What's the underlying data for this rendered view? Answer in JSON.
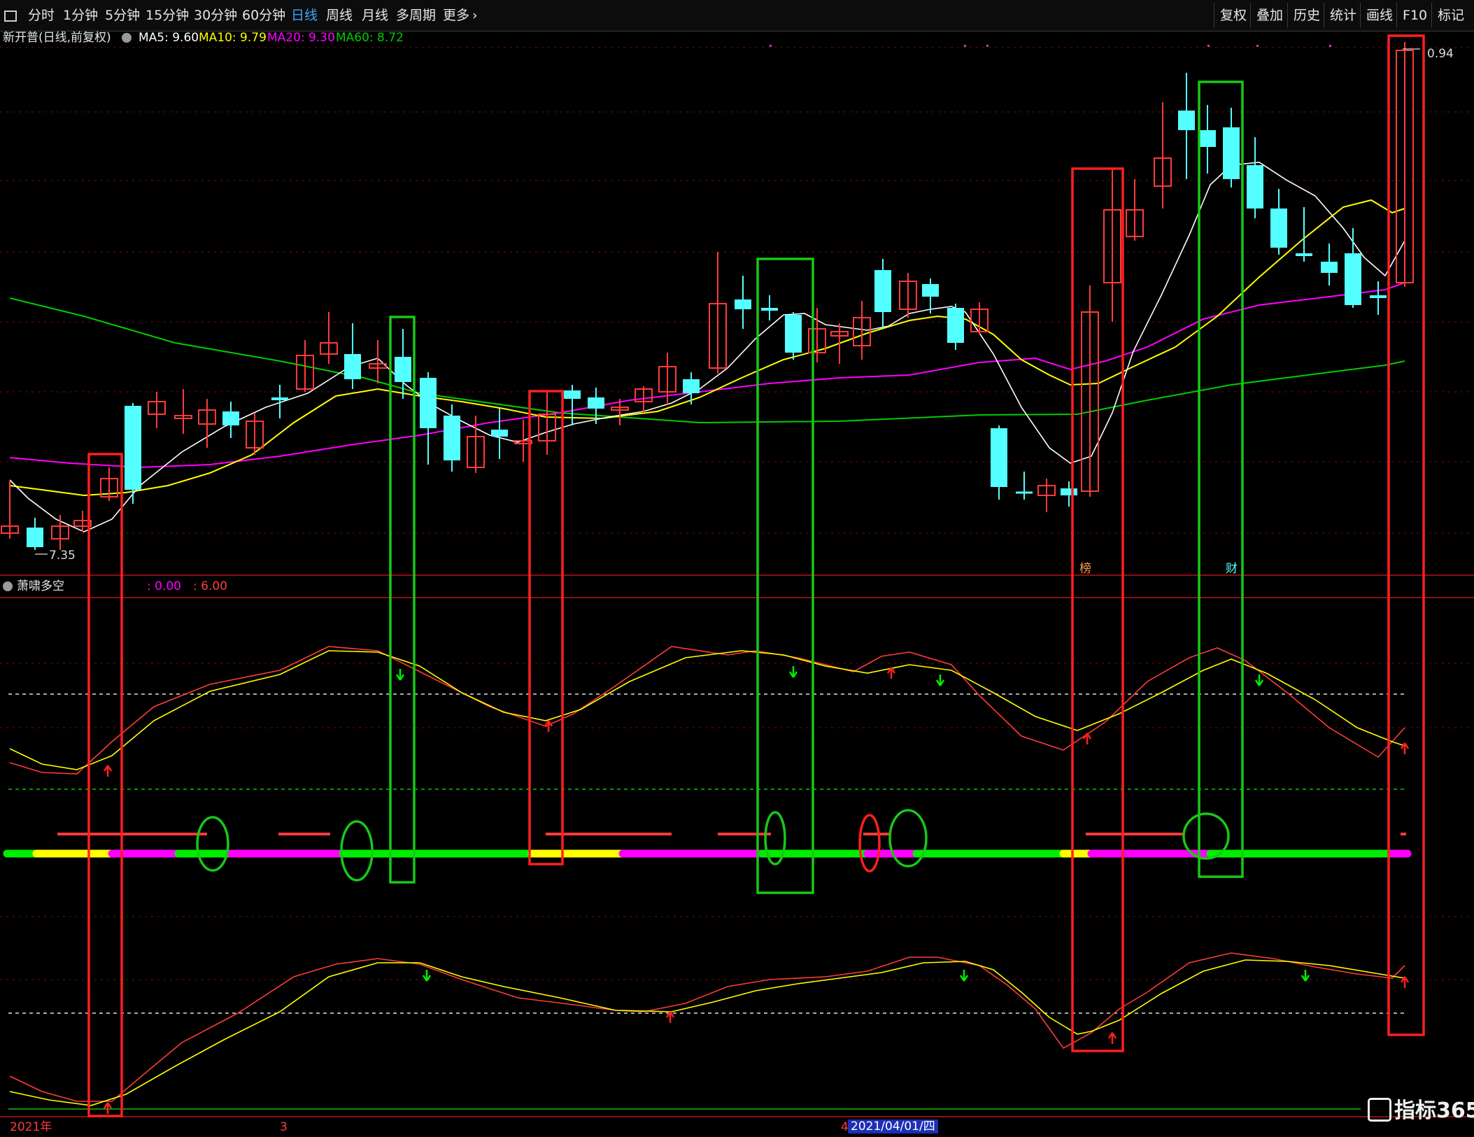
{
  "toolbar": {
    "menu_icon": "square-menu-icon",
    "periods": [
      "分时",
      "1分钟",
      "5分钟",
      "15分钟",
      "30分钟",
      "60分钟",
      "日线",
      "周线",
      "月线",
      "多周期",
      "更多"
    ],
    "active_period": "日线",
    "right_buttons": [
      "复权",
      "叠加",
      "历史",
      "统计",
      "画线",
      "F10",
      "标记"
    ]
  },
  "stock": {
    "name": "新开普(日线,前复权)",
    "ma5": "MA5: 9.60",
    "ma10": "MA10: 9.79",
    "ma20": "MA20: 9.30",
    "ma60": "MA60: 8.72",
    "low_label": "7.35",
    "high_label": "0.94",
    "marker_bang": "榜",
    "marker_cai": "财"
  },
  "indicator": {
    "name": "萧啸多空",
    "value1": ": 0.00",
    "value2": ": 6.00"
  },
  "date_axis": {
    "year_label": "2021年",
    "month_label": "3",
    "digit_label": "4",
    "cursor_date": "2021/04/01/四"
  },
  "colors": {
    "up": "#ff3b3b",
    "down": "#54ffff",
    "ma5": "#ffffff",
    "ma10": "#ffff00",
    "ma20": "#ff00ff",
    "ma60": "#00cc00",
    "toolbar_active": "#39a8ff"
  },
  "logo": {
    "text": "指标365",
    "icon": "z-logo-icon"
  }
}
